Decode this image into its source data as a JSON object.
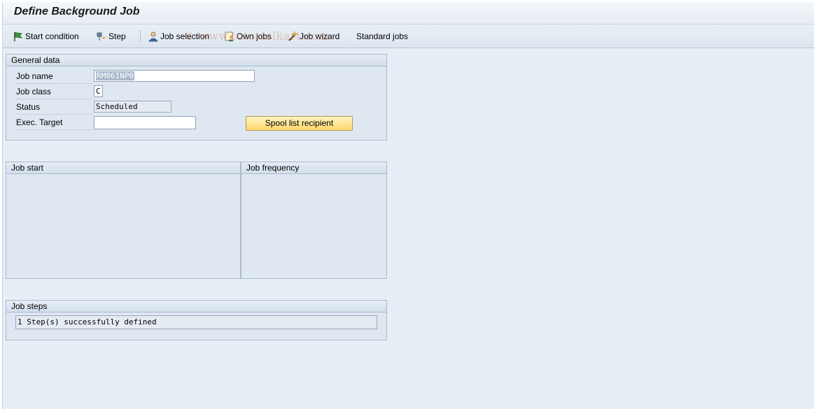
{
  "window": {
    "title": "Define Background Job"
  },
  "toolbar": {
    "items": [
      {
        "label": "Start condition",
        "icon": "flag-icon"
      },
      {
        "label": "Step",
        "icon": "step-icon"
      },
      {
        "label": "Job selection",
        "icon": "person-icon"
      },
      {
        "label": "Own jobs",
        "icon": "document-person-icon"
      },
      {
        "label": "Job wizard",
        "icon": "wand-icon"
      },
      {
        "label": "Standard jobs"
      }
    ]
  },
  "watermark": "© www.tutorialkart.com",
  "general_data": {
    "title": "General data",
    "job_name_label": "Job name",
    "job_name_value": "RM06INP0",
    "job_class_label": "Job class",
    "job_class_value": "C",
    "status_label": "Status",
    "status_value": "Scheduled",
    "exec_target_label": "Exec. Target",
    "exec_target_value": "",
    "spool_button_label": "Spool list recipient"
  },
  "job_start": {
    "title": "Job start"
  },
  "job_frequency": {
    "title": "Job frequency"
  },
  "job_steps": {
    "title": "Job steps",
    "message": "1 Step(s) successfully defined"
  }
}
